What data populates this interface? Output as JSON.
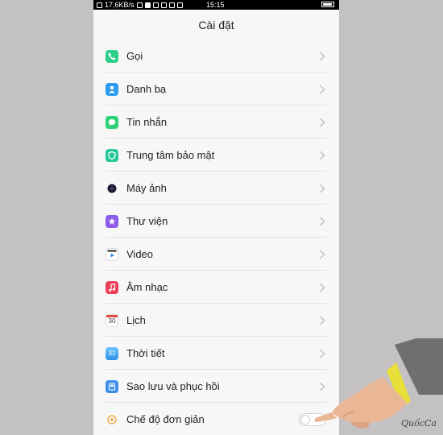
{
  "status_bar": {
    "speed": "17,6KB/s",
    "time": "15:15"
  },
  "header": {
    "title": "Cài đặt"
  },
  "settings": {
    "items": [
      {
        "label": "Gọi",
        "icon": "phone-icon",
        "color": "#2ecf8a"
      },
      {
        "label": "Danh bạ",
        "icon": "contacts-icon",
        "color": "#2b9bf0"
      },
      {
        "label": "Tin nhắn",
        "icon": "messages-icon",
        "color": "#30d277"
      },
      {
        "label": "Trung tâm bảo mật",
        "icon": "shield-icon",
        "color": "#25c79b"
      },
      {
        "label": "Máy ảnh",
        "icon": "camera-icon",
        "color": "#1d1d35"
      },
      {
        "label": "Thư viện",
        "icon": "gallery-icon",
        "color": "#8d5ce8"
      },
      {
        "label": "Video",
        "icon": "video-icon",
        "color": "#2f86e8"
      },
      {
        "label": "Âm nhạc",
        "icon": "music-icon",
        "color": "#ee3f5a"
      },
      {
        "label": "Lịch",
        "icon": "calendar-icon",
        "color": "#e5483e",
        "icon_text": "30"
      },
      {
        "label": "Thời tiết",
        "icon": "weather-icon",
        "color": "#3aa8f0",
        "icon_text": "31"
      },
      {
        "label": "Sao lưu và phục hồi",
        "icon": "backup-icon",
        "color": "#3d8fe8"
      }
    ],
    "simple_mode": {
      "label": "Chế độ đơn giản",
      "icon": "simple-mode-icon",
      "color": "#f0a02a",
      "enabled": false
    }
  },
  "watermark": "QuốcCa"
}
